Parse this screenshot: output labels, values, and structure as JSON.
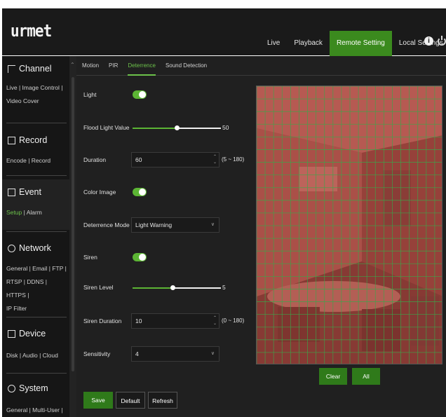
{
  "brand": "urmet",
  "nav": {
    "live": "Live",
    "playback": "Playback",
    "remote_setting": "Remote Setting",
    "local_settings": "Local Settings"
  },
  "icons": {
    "info": "info-icon",
    "power": "power-icon"
  },
  "sidebar": {
    "channel": {
      "title": "Channel",
      "links": [
        "Live | Image Control |",
        "Video Cover"
      ]
    },
    "record": {
      "title": "Record",
      "links": [
        "Encode | Record"
      ]
    },
    "event": {
      "title": "Event",
      "link_active": "Setup",
      "link_sep": " | ",
      "link_other": "Alarm"
    },
    "network": {
      "title": "Network",
      "links": [
        "General | Email | FTP |",
        "RTSP | DDNS | HTTPS |",
        "IP Filter"
      ]
    },
    "device": {
      "title": "Device",
      "links": [
        "Disk | Audio | Cloud"
      ]
    },
    "system": {
      "title": "System",
      "links": [
        "General | Multi-User |"
      ]
    }
  },
  "tabs": [
    "Motion",
    "PIR",
    "Deterrence",
    "Sound Detection"
  ],
  "active_tab_index": 2,
  "form": {
    "light": {
      "label": "Light",
      "on": true
    },
    "flood_light_value": {
      "label": "Flood Light Value",
      "value": "50",
      "level": 0.5
    },
    "duration": {
      "label": "Duration",
      "value": "60",
      "hint": "(5 ~ 180)"
    },
    "color_image": {
      "label": "Color Image",
      "on": true
    },
    "deterrence_mode": {
      "label": "Deterrence Mode",
      "value": "Light Warning"
    },
    "siren": {
      "label": "Siren",
      "on": true
    },
    "siren_level": {
      "label": "Siren Level",
      "value": "5",
      "level": 0.45
    },
    "siren_duration": {
      "label": "Siren Duration",
      "value": "10",
      "hint": "(0 ~ 180)"
    },
    "sensitivity": {
      "label": "Sensitivity",
      "value": "4"
    }
  },
  "preview": {
    "overlay_color": "#b0463f",
    "grid_color": "#3aa84a",
    "grid_cols": 22,
    "grid_rows": 22
  },
  "buttons": {
    "clear": "Clear",
    "all": "All",
    "save": "Save",
    "default": "Default",
    "refresh": "Refresh"
  },
  "colors": {
    "accent": "#3b8a1e",
    "toggle_on": "#5cb534"
  }
}
